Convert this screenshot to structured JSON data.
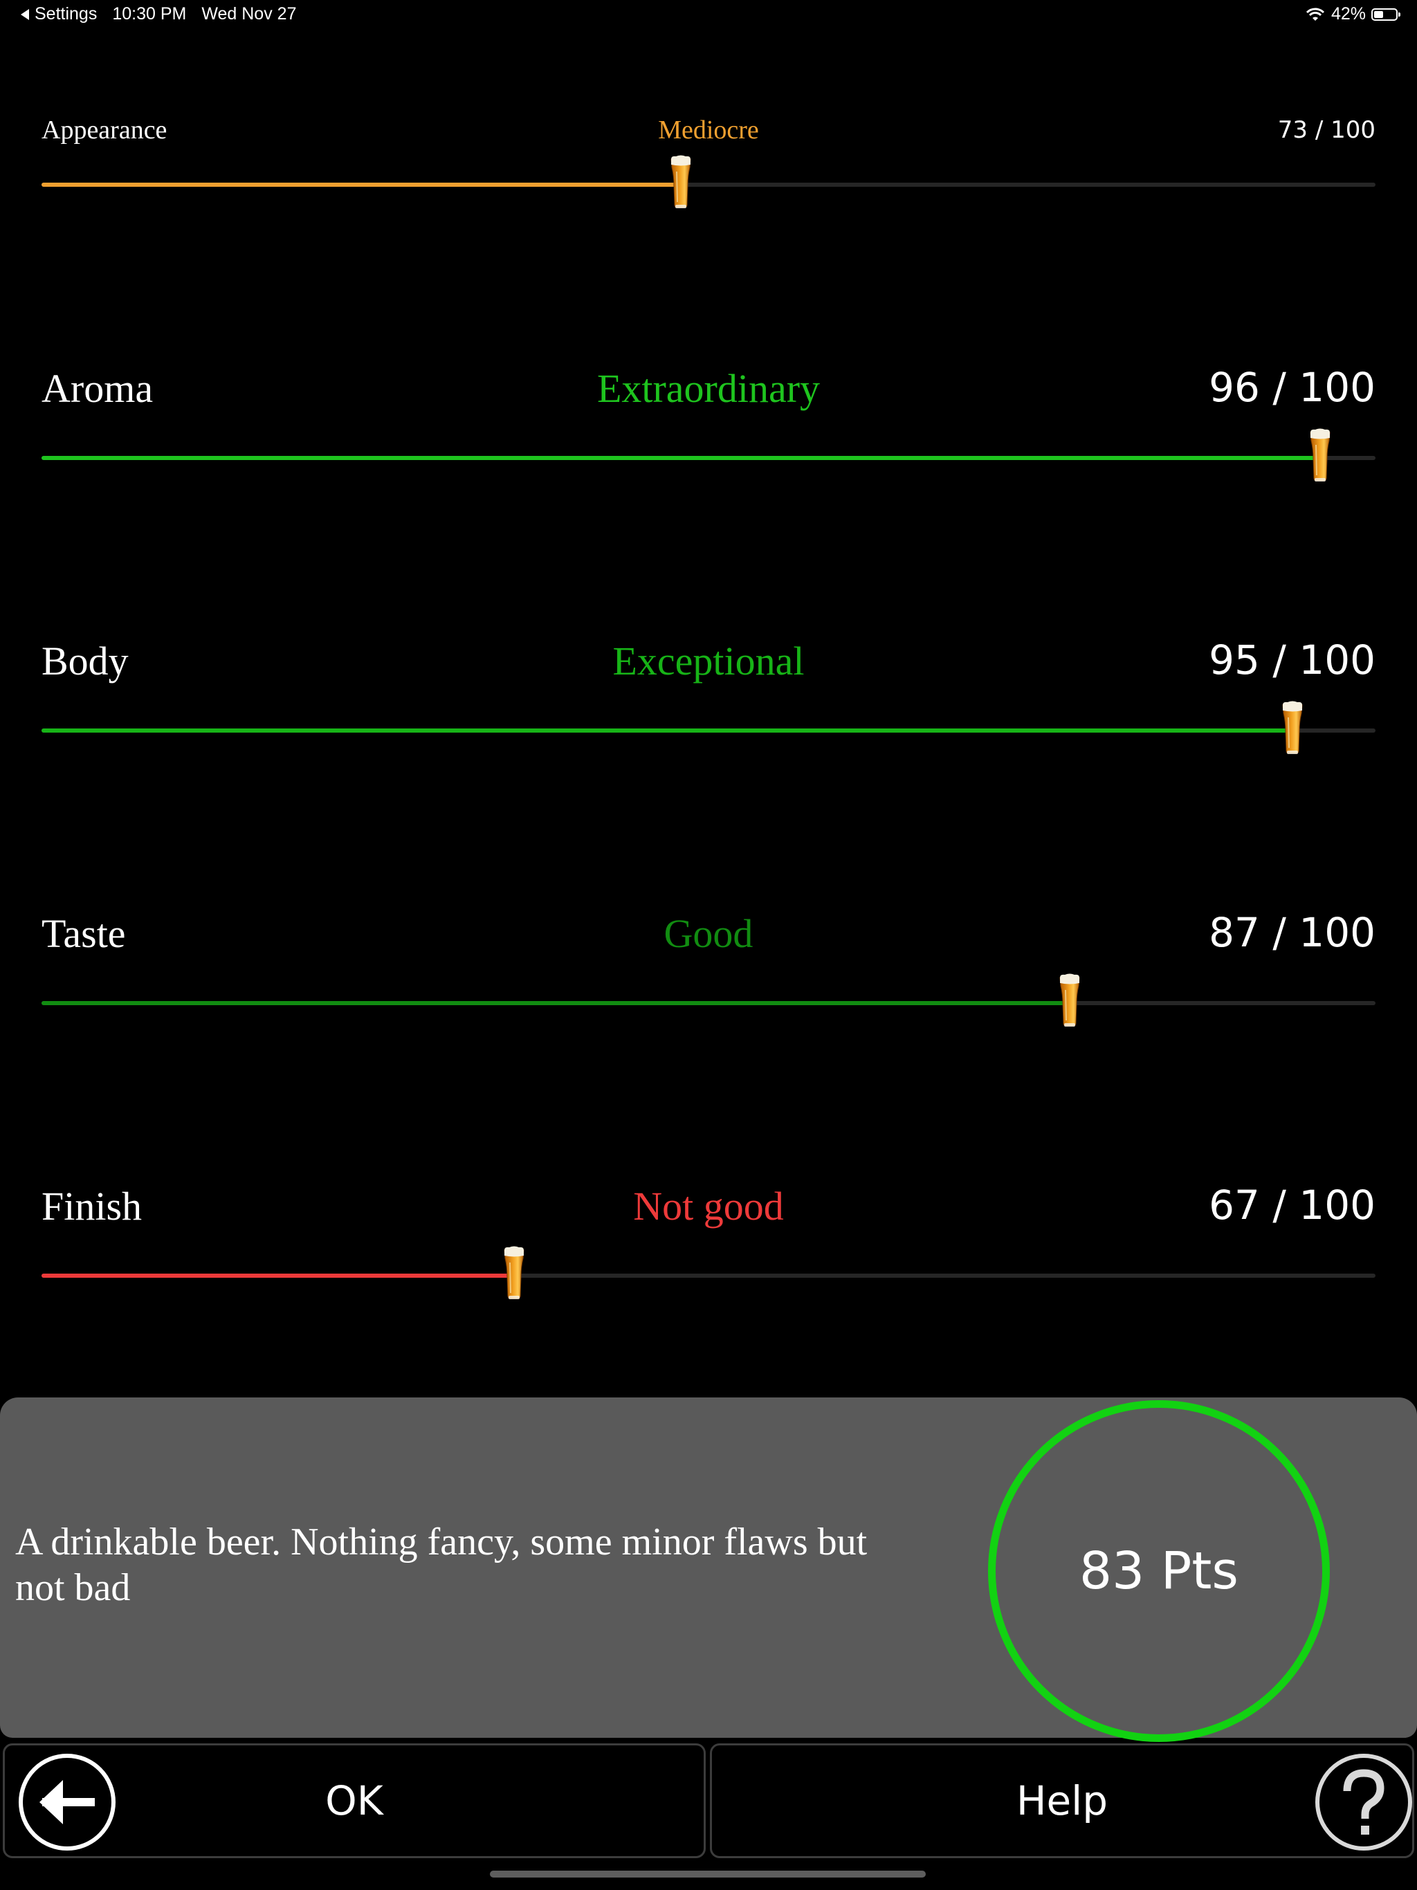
{
  "status_bar": {
    "back_app": "Settings",
    "time": "10:30 PM",
    "date": "Wed Nov 27",
    "battery": "42%",
    "battery_level": 0.42
  },
  "ratings": [
    {
      "label": "Appearance",
      "descriptor": "Mediocre",
      "score": "73 / 100",
      "value": 73,
      "color": "#f0a030"
    },
    {
      "label": "Aroma",
      "descriptor": "Extraordinary",
      "score": "96 / 100",
      "value": 96,
      "color": "#1ec41e"
    },
    {
      "label": "Body",
      "descriptor": "Exceptional",
      "score": "95 / 100",
      "value": 95,
      "color": "#17b417"
    },
    {
      "label": "Taste",
      "descriptor": "Good",
      "score": "87 / 100",
      "value": 87,
      "color": "#118c11"
    },
    {
      "label": "Finish",
      "descriptor": "Not good",
      "score": "67 / 100",
      "value": 67,
      "color": "#ee3a3a"
    }
  ],
  "summary": {
    "text": "A drinkable beer. Nothing fancy, some minor flaws but not bad",
    "points": "83 Pts",
    "ring_color": "#12d212"
  },
  "buttons": {
    "ok_label": "OK",
    "help_label": "Help",
    "ok_icon": "back-arrow-icon",
    "help_icon": "question-mark-icon"
  },
  "slider_icon": "beer-glass-icon"
}
